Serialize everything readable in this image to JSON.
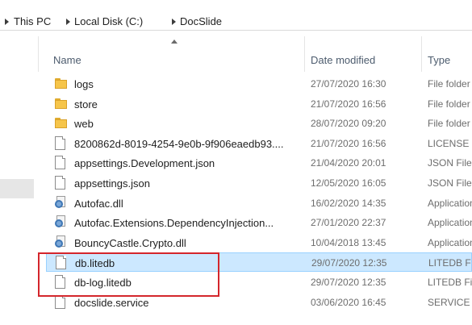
{
  "breadcrumb": [
    "This PC",
    "Local Disk (C:)",
    "DocSlide"
  ],
  "columns": {
    "name": "Name",
    "date": "Date modified",
    "type": "Type"
  },
  "rows": [
    {
      "name": "logs",
      "date": "27/07/2020 16:30",
      "type": "File folder",
      "icon": "folder-icon"
    },
    {
      "name": "store",
      "date": "21/07/2020 16:56",
      "type": "File folder",
      "icon": "folder-icon"
    },
    {
      "name": "web",
      "date": "28/07/2020 09:20",
      "type": "File folder",
      "icon": "folder-icon"
    },
    {
      "name": "8200862d-8019-4254-9e0b-9f906eaedb93....",
      "date": "21/07/2020 16:56",
      "type": "LICENSE",
      "icon": "file-icon"
    },
    {
      "name": "appsettings.Development.json",
      "date": "21/04/2020 20:01",
      "type": "JSON File",
      "icon": "file-icon"
    },
    {
      "name": "appsettings.json",
      "date": "12/05/2020 16:05",
      "type": "JSON File",
      "icon": "file-icon"
    },
    {
      "name": "Autofac.dll",
      "date": "16/02/2020 14:35",
      "type": "Application",
      "icon": "dll-icon"
    },
    {
      "name": "Autofac.Extensions.DependencyInjection...",
      "date": "27/01/2020 22:37",
      "type": "Application",
      "icon": "dll-icon"
    },
    {
      "name": "BouncyCastle.Crypto.dll",
      "date": "10/04/2018 13:45",
      "type": "Application",
      "icon": "dll-icon"
    },
    {
      "name": "db.litedb",
      "date": "29/07/2020 12:35",
      "type": "LITEDB File",
      "icon": "file-icon",
      "selected": true
    },
    {
      "name": "db-log.litedb",
      "date": "29/07/2020 12:35",
      "type": "LITEDB File",
      "icon": "file-icon"
    },
    {
      "name": "docslide.service",
      "date": "03/06/2020 16:45",
      "type": "SERVICE",
      "icon": "file-icon"
    }
  ],
  "colors": {
    "selection": "#cce8ff",
    "selection_border": "#99d1ff",
    "highlight": "#d4262c",
    "folder": "#f6c54a"
  }
}
